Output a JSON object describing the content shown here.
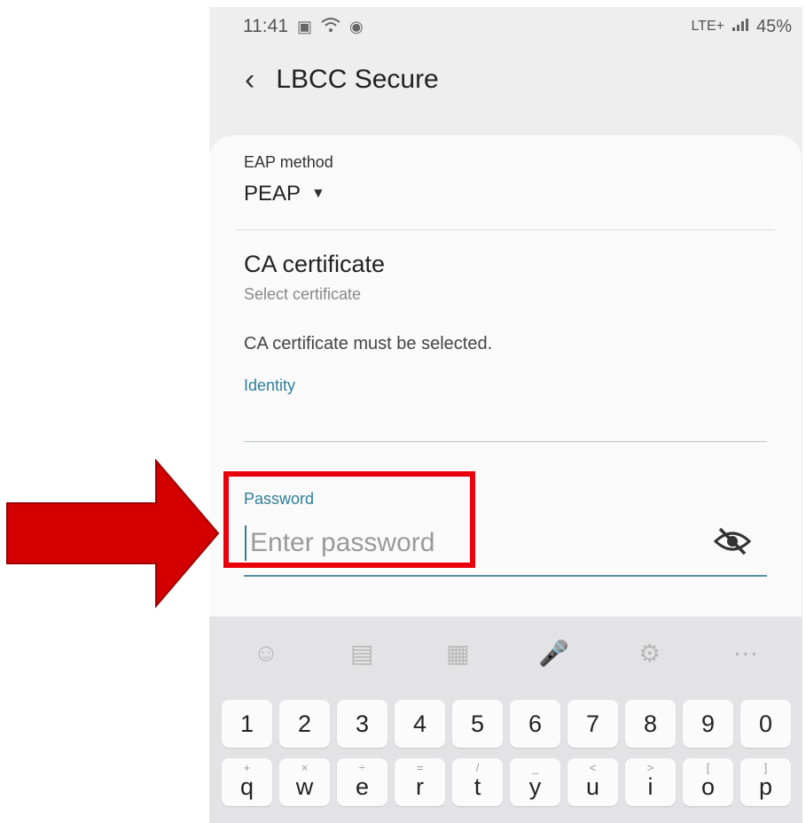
{
  "status_bar": {
    "time": "11:41",
    "network": "LTE+",
    "battery": "45%"
  },
  "header": {
    "title": "LBCC Secure"
  },
  "form": {
    "eap_label": "EAP method",
    "eap_value": "PEAP",
    "ca_title": "CA certificate",
    "ca_subtitle": "Select certificate",
    "ca_error": "CA certificate must be selected.",
    "identity_label": "Identity",
    "identity_value": "",
    "password_label": "Password",
    "password_placeholder": "Enter password"
  },
  "keyboard": {
    "number_row": [
      "1",
      "2",
      "3",
      "4",
      "5",
      "6",
      "7",
      "8",
      "9",
      "0"
    ],
    "letter_row": [
      {
        "key": "q",
        "hint": "+"
      },
      {
        "key": "w",
        "hint": "×"
      },
      {
        "key": "e",
        "hint": "÷"
      },
      {
        "key": "r",
        "hint": "="
      },
      {
        "key": "t",
        "hint": "/"
      },
      {
        "key": "y",
        "hint": "_"
      },
      {
        "key": "u",
        "hint": "<"
      },
      {
        "key": "i",
        "hint": ">"
      },
      {
        "key": "o",
        "hint": "["
      },
      {
        "key": "p",
        "hint": "]"
      }
    ]
  },
  "colors": {
    "accent": "#2f7f9a",
    "highlight": "#e8000b",
    "arrow": "#d40000"
  }
}
